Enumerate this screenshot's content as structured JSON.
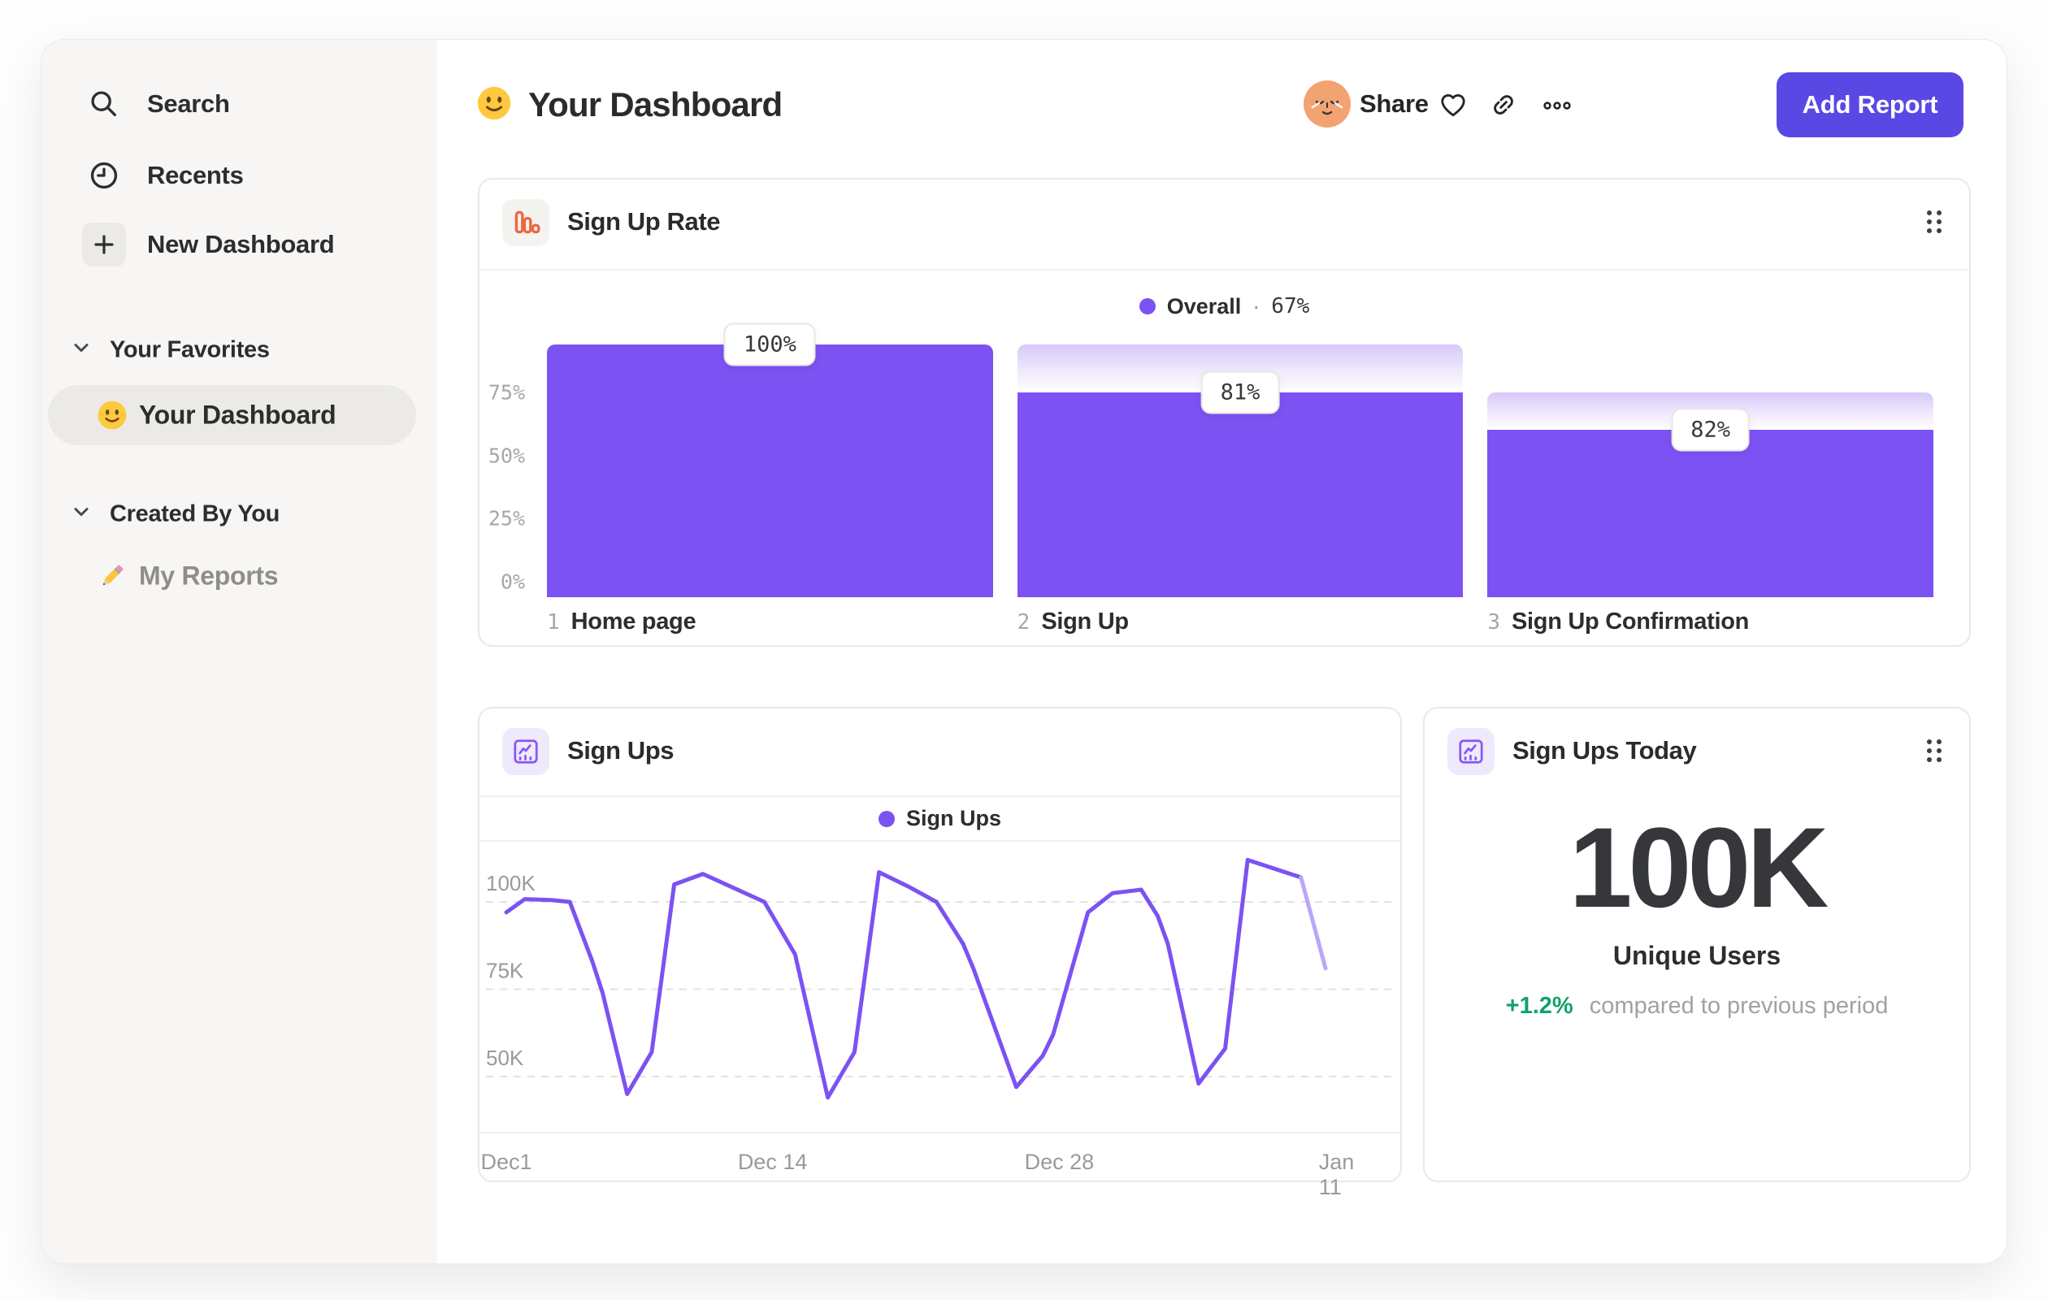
{
  "sidebar": {
    "nav": [
      {
        "label": "Search"
      },
      {
        "label": "Recents"
      },
      {
        "label": "New Dashboard"
      }
    ],
    "sections": [
      {
        "title": "Your Favorites",
        "items": [
          {
            "label": "Your Dashboard",
            "icon": "smiley-emoji",
            "active": true
          }
        ]
      },
      {
        "title": "Created By You",
        "items": [
          {
            "label": "My Reports",
            "icon": "pencil-emoji",
            "active": false
          }
        ]
      }
    ]
  },
  "header": {
    "title": "Your Dashboard",
    "title_icon": "smiley-emoji",
    "share_label": "Share",
    "add_report_label": "Add Report"
  },
  "colors": {
    "accent_purple": "#7c52f3",
    "accent_purple_light": "#bba6f8",
    "button_indigo": "#5a48e5",
    "funnel_icon_orange": "#eb6841",
    "positive_green": "#12a269",
    "sidebar_bg": "#f7f6f4"
  },
  "chart_data": [
    {
      "id": "sign_up_rate",
      "type": "bar",
      "title": "Sign Up Rate",
      "legend": {
        "series": "Overall",
        "separator": "·",
        "value": "67%"
      },
      "ylim": [
        0,
        100
      ],
      "y_ticks": [
        "75%",
        "50%",
        "25%",
        "0%"
      ],
      "grid": false,
      "steps": [
        {
          "index": "1",
          "label": "Home page",
          "badge": "100%",
          "conversion_pct": 100,
          "cumulative_pct": 100
        },
        {
          "index": "2",
          "label": "Sign Up",
          "badge": "81%",
          "conversion_pct": 81,
          "cumulative_pct": 81
        },
        {
          "index": "3",
          "label": "Sign Up Confirmation",
          "badge": "82%",
          "conversion_pct": 82,
          "cumulative_pct": 66.4
        }
      ]
    },
    {
      "id": "sign_ups",
      "type": "line",
      "title": "Sign Ups",
      "legend": {
        "series": "Sign Ups"
      },
      "unit": "K users",
      "ylim": [
        40,
        115
      ],
      "grid": "dashed-horizontal",
      "legend_position": "top-center",
      "y_ticks": [
        {
          "label": "100K",
          "value": 100
        },
        {
          "label": "75K",
          "value": 75
        },
        {
          "label": "50K",
          "value": 50
        }
      ],
      "x_ticks": [
        {
          "label": "Dec1",
          "day": 0
        },
        {
          "label": "Dec 14",
          "day": 13
        },
        {
          "label": "Dec 28",
          "day": 27
        },
        {
          "label": "Jan 11",
          "day": 41
        }
      ],
      "points": [
        [
          0,
          97
        ],
        [
          0.9,
          100.8
        ],
        [
          2.2,
          100.5
        ],
        [
          3.1,
          100
        ],
        [
          4.2,
          83
        ],
        [
          4.7,
          74
        ],
        [
          5.9,
          45
        ],
        [
          7.1,
          57
        ],
        [
          8.2,
          105
        ],
        [
          9.6,
          108
        ],
        [
          11.1,
          104
        ],
        [
          12.6,
          100
        ],
        [
          13.7,
          89
        ],
        [
          14.1,
          85
        ],
        [
          15.7,
          44
        ],
        [
          17,
          57
        ],
        [
          18.2,
          108.5
        ],
        [
          19.6,
          104.5
        ],
        [
          21,
          100
        ],
        [
          22.3,
          88
        ],
        [
          22.8,
          81
        ],
        [
          24.9,
          47
        ],
        [
          26.2,
          56
        ],
        [
          26.7,
          62
        ],
        [
          28.4,
          97
        ],
        [
          29.6,
          102.5
        ],
        [
          31,
          103.5
        ],
        [
          31.8,
          96
        ],
        [
          32.3,
          88
        ],
        [
          33.8,
          48
        ],
        [
          35.1,
          58
        ],
        [
          36.2,
          112
        ],
        [
          37.5,
          109.5
        ],
        [
          38.8,
          107
        ],
        [
          40,
          81
        ]
      ],
      "incomplete_tail_points": 1
    },
    {
      "id": "sign_ups_today",
      "type": "big_number",
      "title": "Sign Ups Today",
      "value": "100K",
      "value_label": "Unique Users",
      "delta": "+1.2%",
      "delta_description": "compared to previous period"
    }
  ]
}
